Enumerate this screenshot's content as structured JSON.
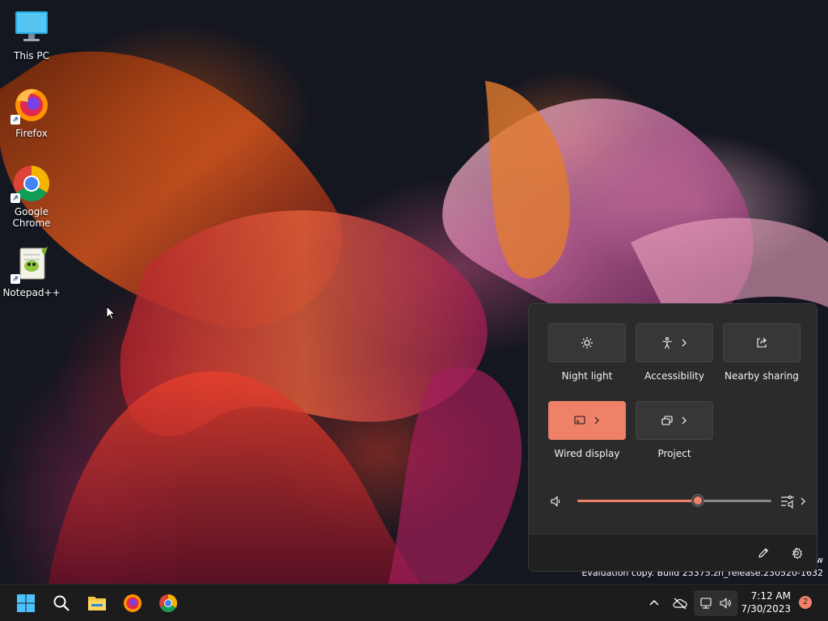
{
  "desktop": {
    "icons": [
      {
        "label": "This PC",
        "icon": "this-pc-icon"
      },
      {
        "label": "Firefox",
        "icon": "firefox-icon"
      },
      {
        "label": "Google\nChrome",
        "icon": "chrome-icon"
      },
      {
        "label": "Notepad++",
        "icon": "notepadpp-icon"
      }
    ]
  },
  "quick_settings": {
    "tiles": [
      {
        "label": "Night light",
        "icon": "night-light-icon",
        "active": false,
        "has_arrow": false
      },
      {
        "label": "Accessibility",
        "icon": "accessibility-icon",
        "active": false,
        "has_arrow": true
      },
      {
        "label": "Nearby sharing",
        "icon": "share-icon",
        "active": false,
        "has_arrow": false
      },
      {
        "label": "Wired display",
        "icon": "cast-icon",
        "active": true,
        "has_arrow": true
      },
      {
        "label": "Project",
        "icon": "project-icon",
        "active": false,
        "has_arrow": true
      }
    ],
    "volume": {
      "level": 0.62,
      "icon": "speaker-icon"
    },
    "footer": {
      "edit_icon": "pencil-icon",
      "settings_icon": "gear-icon"
    }
  },
  "watermark": {
    "line1": "w",
    "line2": "Evaluation copy. Build 25375.zn_release.230520-1632"
  },
  "taskbar": {
    "items": [
      "start-icon",
      "search-icon",
      "file-explorer-icon",
      "firefox-icon",
      "chrome-icon"
    ],
    "tray": [
      "chevron-up-icon",
      "cloud-off-icon",
      "network-icon",
      "volume-icon"
    ],
    "time": "7:12 AM",
    "date": "7/30/2023",
    "notifications": "2"
  },
  "colors": {
    "accent": "#ef8168",
    "panel": "#2b2b2b",
    "taskbar": "#1c1c1c"
  }
}
